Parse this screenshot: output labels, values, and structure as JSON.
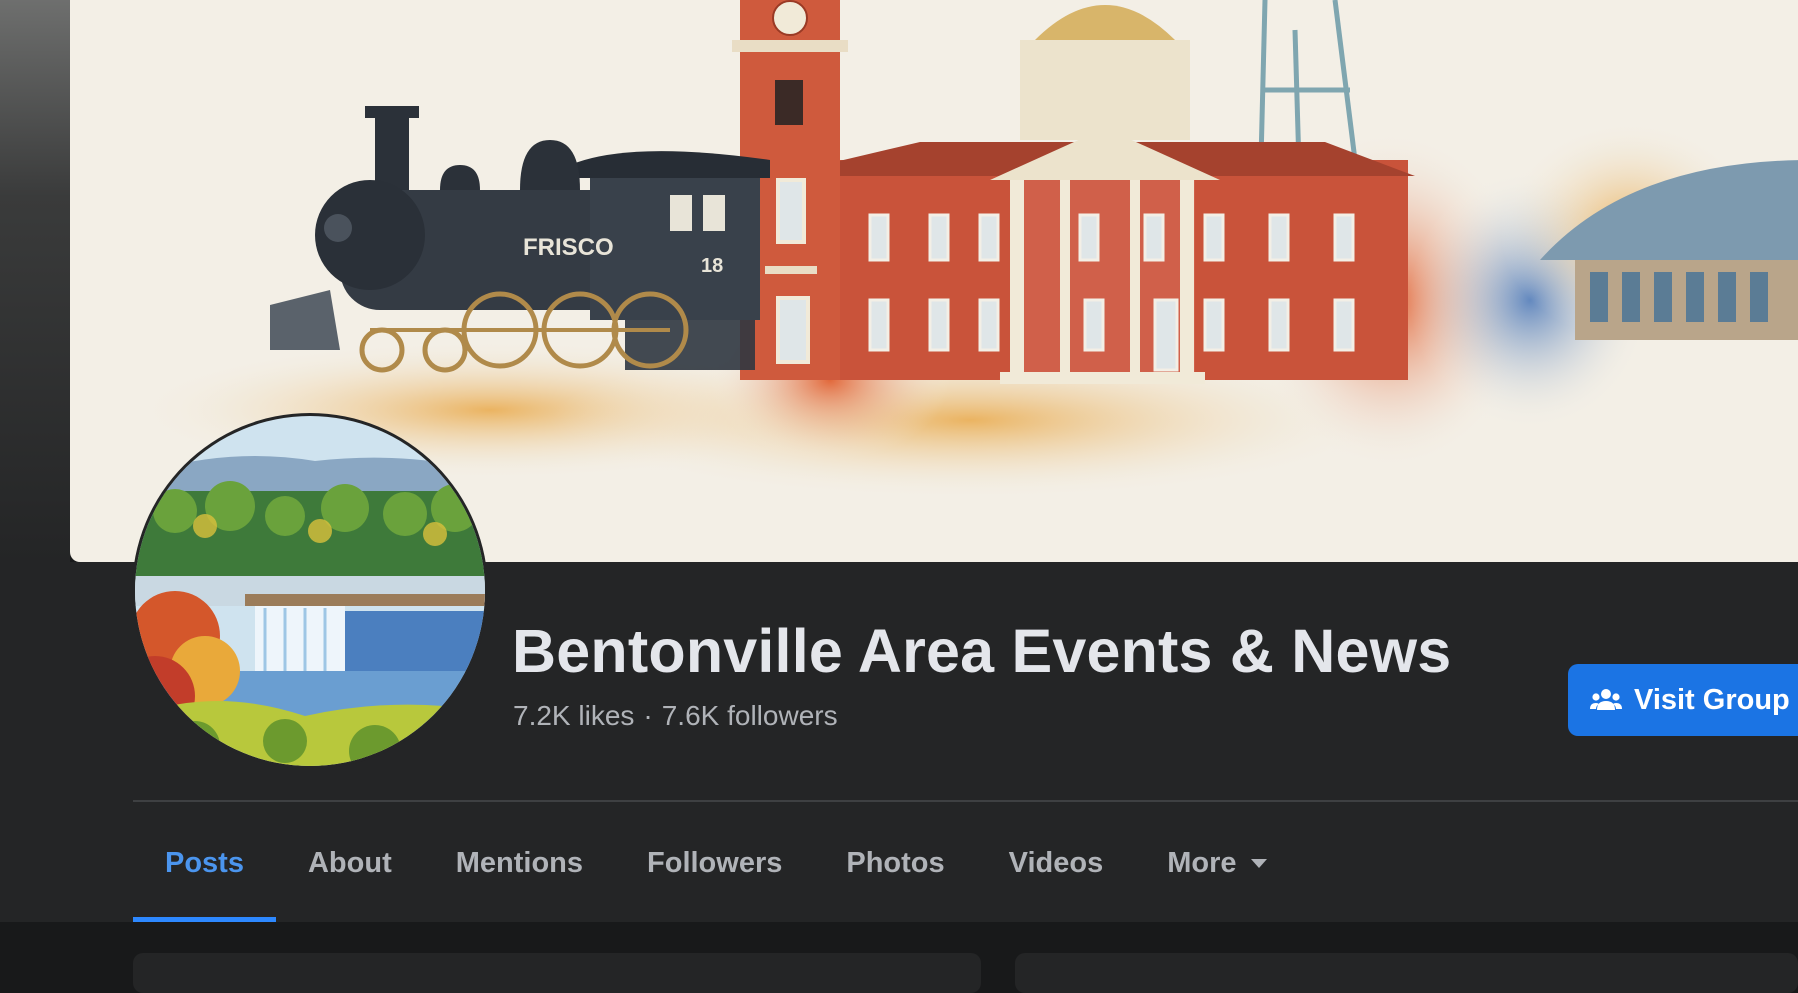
{
  "page": {
    "name": "Bentonville Area Events & News",
    "likes": "7.2K likes",
    "separator": "·",
    "followers": "7.6K followers"
  },
  "cover": {
    "train_label": "FRISCO",
    "train_number": "18"
  },
  "actions": {
    "visit_group_label": "Visit Group",
    "visit_group_icon": "group-icon"
  },
  "tabs": [
    {
      "label": "Posts",
      "active": true
    },
    {
      "label": "About",
      "active": false
    },
    {
      "label": "Mentions",
      "active": false
    },
    {
      "label": "Followers",
      "active": false
    },
    {
      "label": "Photos",
      "active": false
    },
    {
      "label": "Videos",
      "active": false
    },
    {
      "label": "More",
      "active": false,
      "icon": "caret-down-icon"
    }
  ],
  "colors": {
    "background": "#18191a",
    "surface": "#242526",
    "primary_text": "#e4e6eb",
    "secondary_text": "#b0b3b8",
    "accent": "#1b74e4",
    "active_tab": "#4b95ee"
  }
}
